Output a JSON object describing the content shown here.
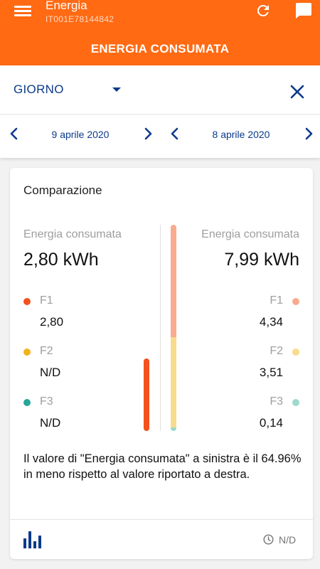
{
  "header": {
    "app_title": "Energia",
    "account_id": "IT001E78144842",
    "page_title": "ENERGIA CONSUMATA"
  },
  "filter": {
    "period": "GIORNO",
    "left_date": "9 aprile 2020",
    "right_date": "8 aprile 2020"
  },
  "card": {
    "title": "Comparazione",
    "left": {
      "label": "Energia consumata",
      "total": "2,80 kWh",
      "bands": [
        {
          "name": "F1",
          "value": "2,80",
          "color": "#f4511e"
        },
        {
          "name": "F2",
          "value": "N/D",
          "color": "#f2b21b"
        },
        {
          "name": "F3",
          "value": "N/D",
          "color": "#26a69a"
        }
      ],
      "bar_segments": [
        {
          "band": "F1",
          "kwh": 2.8
        }
      ]
    },
    "right": {
      "label": "Energia consumata",
      "total": "7,99 kWh",
      "bands": [
        {
          "name": "F1",
          "value": "4,34",
          "color": "#f9ab8e"
        },
        {
          "name": "F2",
          "value": "3,51",
          "color": "#f8dc8c"
        },
        {
          "name": "F3",
          "value": "0,14",
          "color": "#9ed9cb"
        }
      ],
      "bar_segments": [
        {
          "band": "F3",
          "kwh": 0.14
        },
        {
          "band": "F2",
          "kwh": 3.51
        },
        {
          "band": "F1",
          "kwh": 4.34
        }
      ]
    },
    "bar_scale_max_kwh": 7.99,
    "note": "Il valore di \"Energia consumata\" a sinistra è il 64.96% in meno rispetto al valore riportato a destra.",
    "last_update": "N/D"
  }
}
